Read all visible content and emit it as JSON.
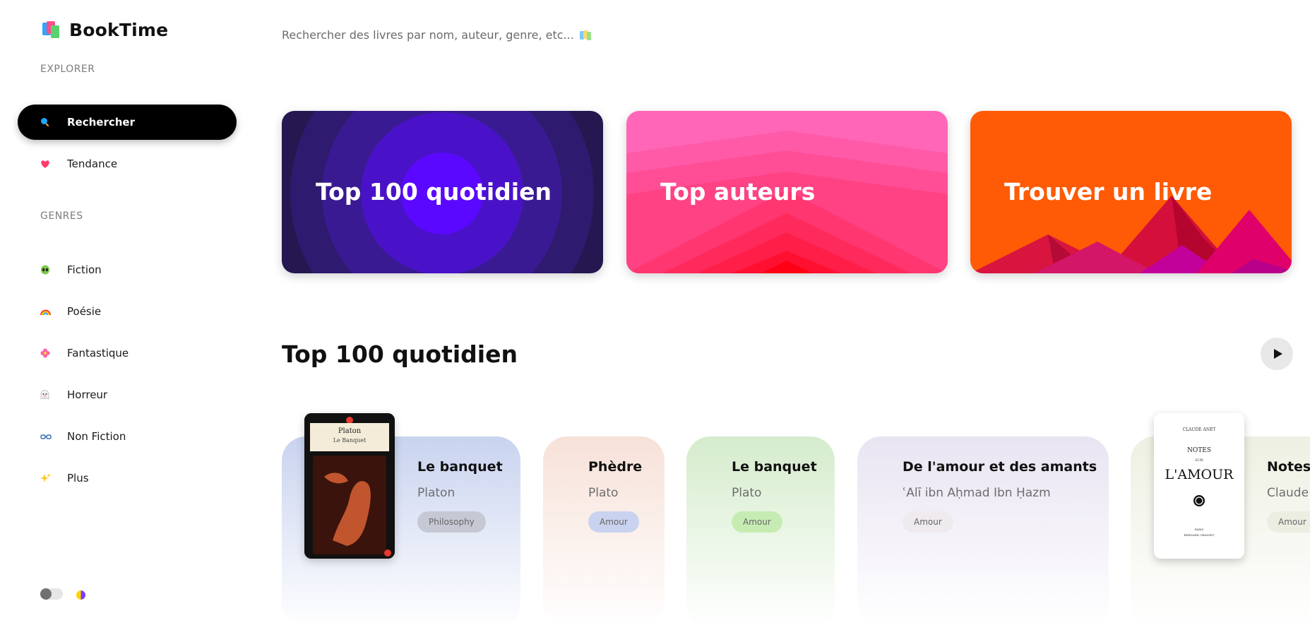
{
  "app": {
    "name": "BookTime"
  },
  "sidebar": {
    "explore_title": "EXPLORER",
    "explore_items": [
      {
        "label": "Rechercher",
        "icon": "search-icon",
        "active": true
      },
      {
        "label": "Tendance",
        "icon": "heart-icon"
      }
    ],
    "genres_title": "GENRES",
    "genre_items": [
      {
        "label": "Fiction",
        "icon": "alien-icon"
      },
      {
        "label": "Poésie",
        "icon": "rainbow-icon"
      },
      {
        "label": "Fantastique",
        "icon": "flower-icon"
      },
      {
        "label": "Horreur",
        "icon": "ghost-icon"
      },
      {
        "label": "Non Fiction",
        "icon": "glasses-icon"
      },
      {
        "label": "Plus",
        "icon": "sparkles-icon"
      }
    ]
  },
  "search": {
    "placeholder": "Rechercher des livres par nom, auteur, genre, etc..."
  },
  "feature_cards": [
    {
      "label": "Top 100 quotidien",
      "color": "#2a1a55"
    },
    {
      "label": "Top auteurs",
      "color": "#ff5fa8"
    },
    {
      "label": "Trouver un livre",
      "color": "#ff5a05"
    }
  ],
  "section": {
    "title": "Top 100 quotidien"
  },
  "books": [
    {
      "title": "Le banquet",
      "author": "Platon",
      "tag": "Philosophy",
      "cover_title": "Platon",
      "cover_subtitle": "Le Banquet"
    },
    {
      "title": "Phèdre",
      "author": "Plato",
      "tag": "Amour"
    },
    {
      "title": "Le banquet",
      "author": "Plato",
      "tag": "Amour"
    },
    {
      "title": "De l'amour et des amants",
      "author": "ʿAlī ibn Aḥmad Ibn Ḥazm",
      "tag": "Amour"
    },
    {
      "title": "Notes",
      "author": "Claude",
      "tag": "Amour",
      "cover_author": "CLAUDE ANET",
      "cover_line1": "NOTES",
      "cover_line2": "SUR",
      "cover_line3": "L'AMOUR",
      "cover_city": "PARIS",
      "cover_publisher": "BERNARD GRASSET"
    }
  ]
}
